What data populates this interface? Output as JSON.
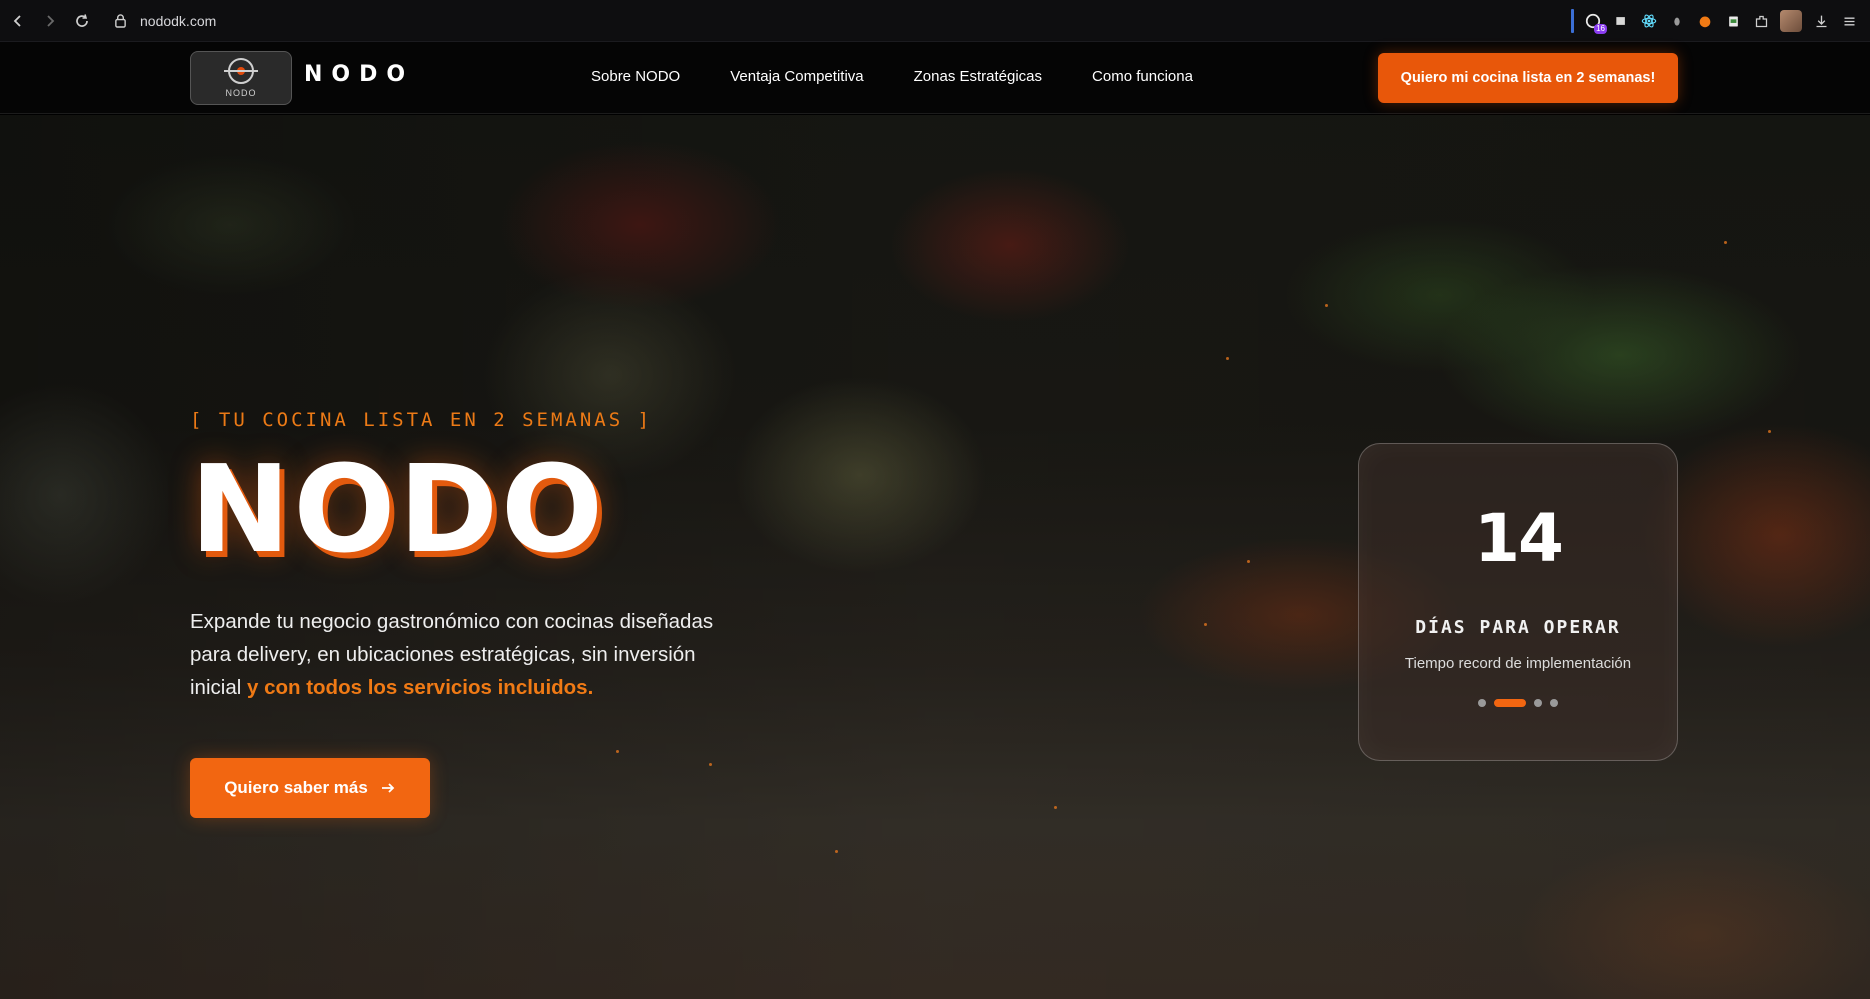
{
  "browser": {
    "url": "nododk.com",
    "extension_badge": "16"
  },
  "header": {
    "logo_small": "NODO",
    "brand": "NODO",
    "nav": [
      {
        "label": "Sobre NODO"
      },
      {
        "label": "Ventaja Competitiva"
      },
      {
        "label": "Zonas Estratégicas"
      },
      {
        "label": "Como funciona"
      }
    ],
    "cta": "Quiero mi cocina lista en 2 semanas!"
  },
  "hero": {
    "eyebrow": "[ TU COCINA LISTA EN 2 SEMANAS ]",
    "title": "NODO",
    "lead_text": "Expande tu negocio gastronómico con cocinas diseñadas para delivery, en ubicaciones estratégicas, sin inversión inicial ",
    "lead_accent": "y con todos los servicios incluidos.",
    "cta": "Quiero saber más"
  },
  "stat_card": {
    "number": "14",
    "label": "DÍAS PARA OPERAR",
    "sub": "Tiempo record de implementación",
    "slides": 4,
    "active_slide": 2
  },
  "colors": {
    "accent": "#f26611",
    "accent_dark": "#e8570a",
    "eyebrow": "#ec7a16"
  }
}
